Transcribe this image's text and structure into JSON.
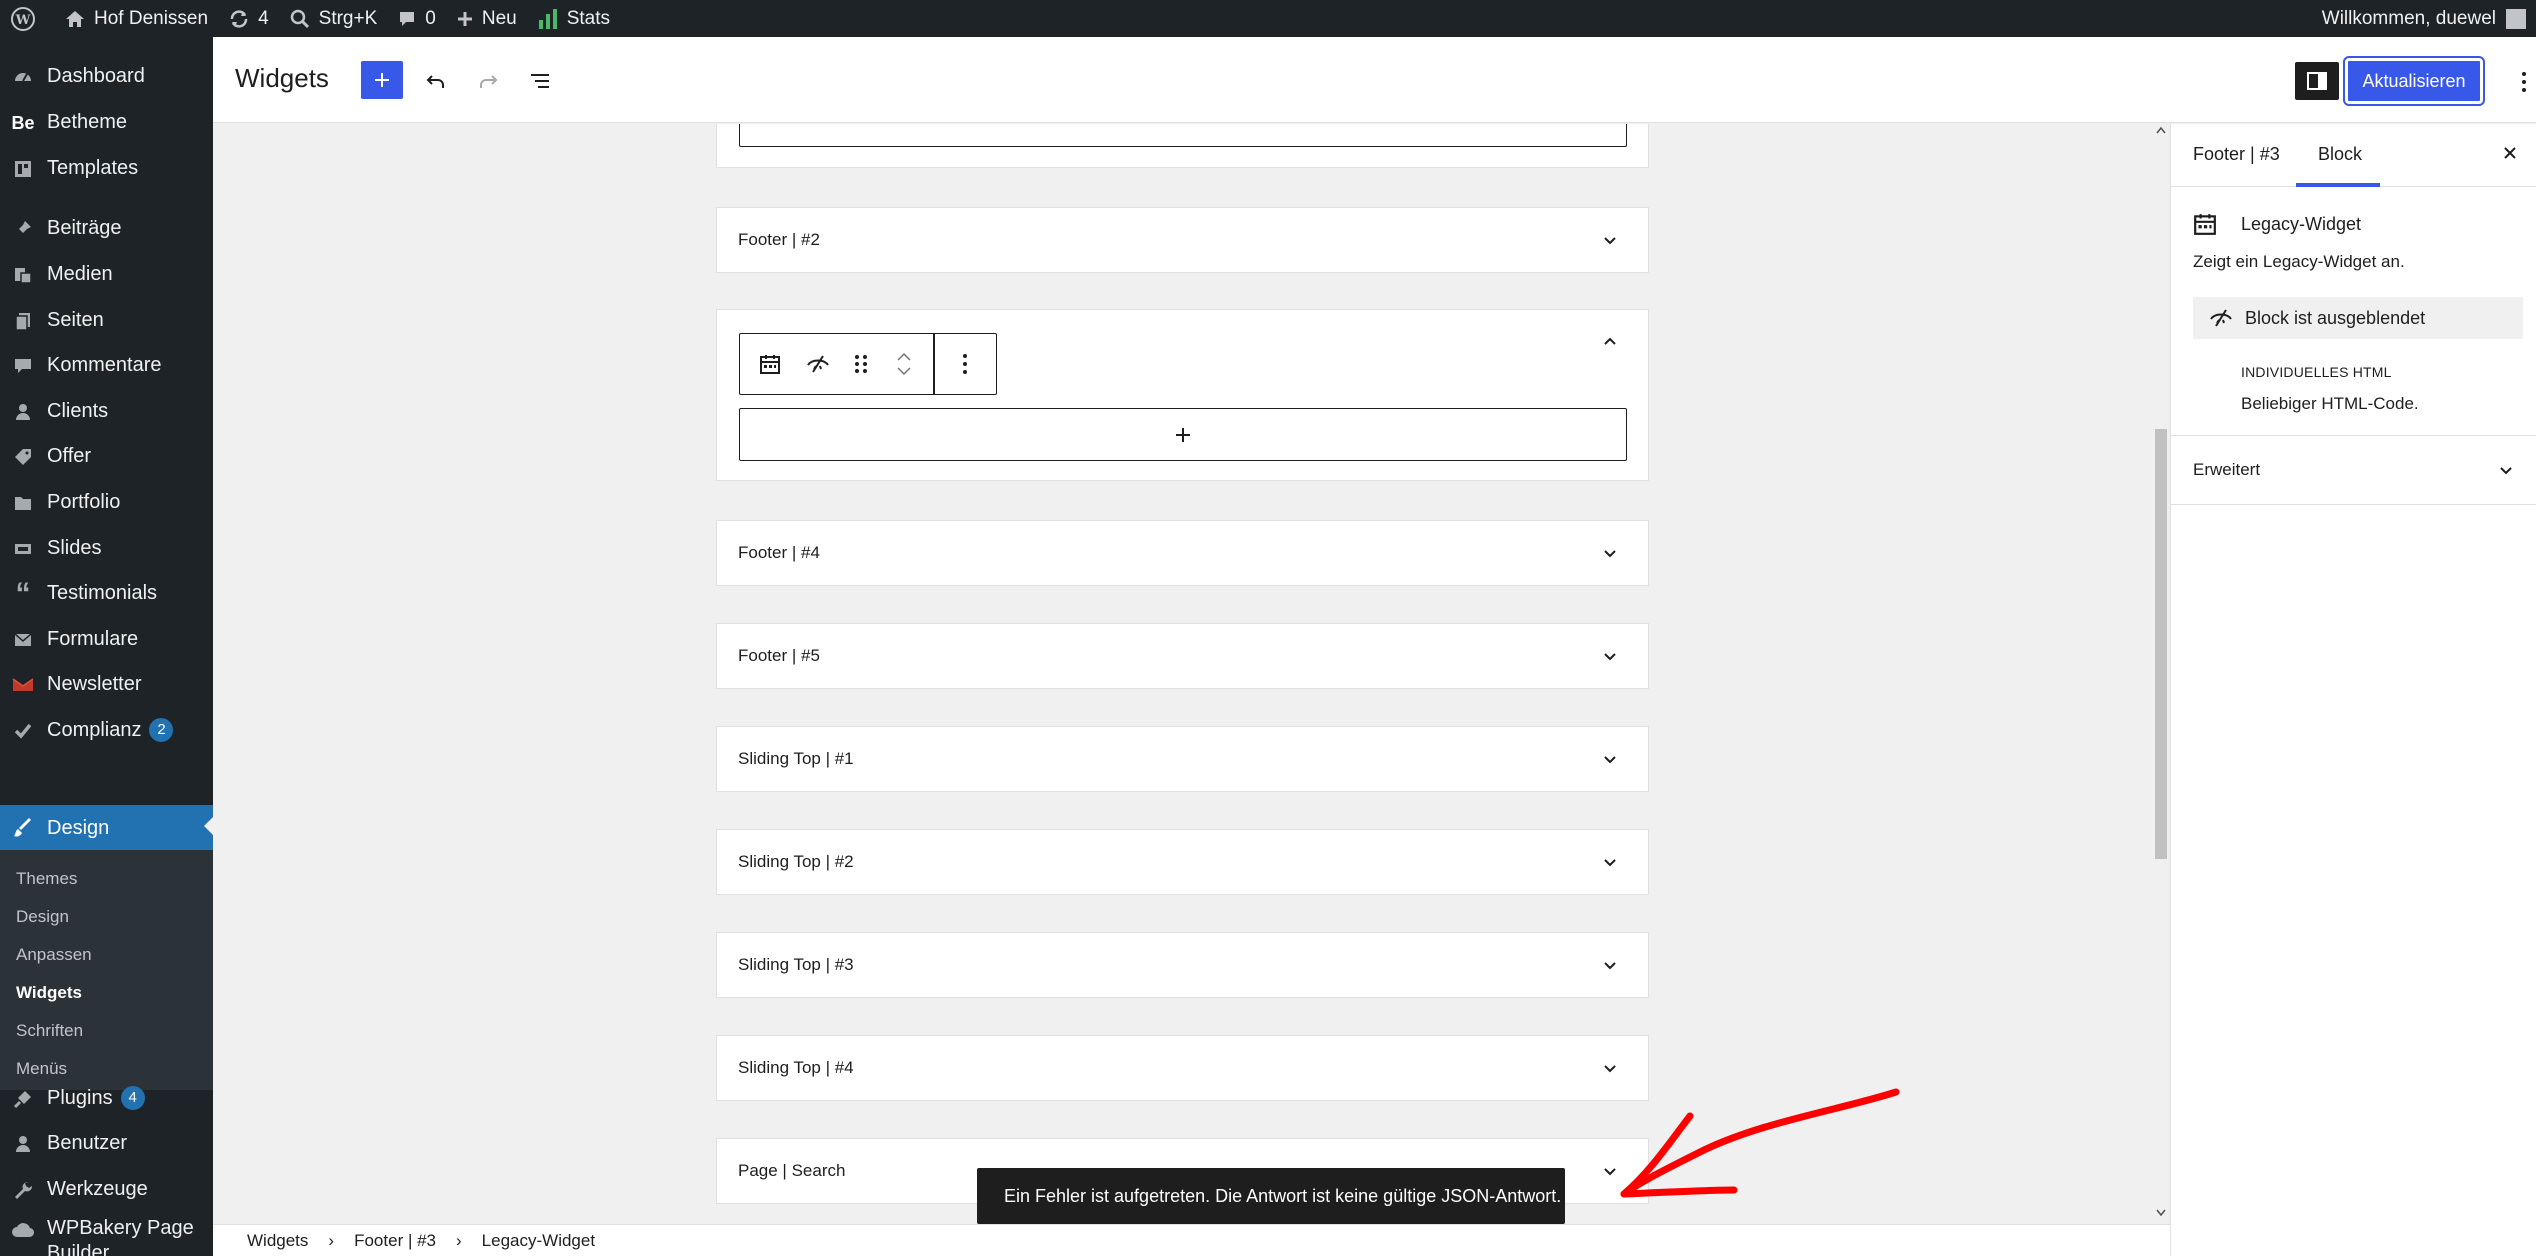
{
  "adminbar": {
    "site_name": "Hof Denissen",
    "updates_count": "4",
    "search_label": "Strg+K",
    "comments_count": "0",
    "new_label": "Neu",
    "stats_label": "Stats",
    "welcome": "Willkommen, duewel"
  },
  "sidebar": {
    "items": [
      {
        "label": "Dashboard",
        "icon": "dashboard-icon"
      },
      {
        "label": "Betheme",
        "icon": "betheme-logo-icon"
      },
      {
        "label": "Templates",
        "icon": "templates-icon"
      },
      {
        "label": "Beiträge",
        "icon": "pin-icon"
      },
      {
        "label": "Medien",
        "icon": "media-icon"
      },
      {
        "label": "Seiten",
        "icon": "pages-icon"
      },
      {
        "label": "Kommentare",
        "icon": "comment-icon"
      },
      {
        "label": "Clients",
        "icon": "user-icon"
      },
      {
        "label": "Offer",
        "icon": "tag-icon"
      },
      {
        "label": "Portfolio",
        "icon": "folder-icon"
      },
      {
        "label": "Slides",
        "icon": "slides-icon"
      },
      {
        "label": "Testimonials",
        "icon": "quote-icon"
      },
      {
        "label": "Formulare",
        "icon": "mail-icon"
      },
      {
        "label": "Newsletter",
        "icon": "newsletter-icon"
      },
      {
        "label": "Complianz",
        "icon": "check-icon",
        "badge": "2"
      },
      {
        "label": "Design",
        "icon": "brush-icon"
      },
      {
        "label": "Plugins",
        "icon": "plugin-icon",
        "badge": "4"
      },
      {
        "label": "Benutzer",
        "icon": "user-icon"
      },
      {
        "label": "Werkzeuge",
        "icon": "wrench-icon"
      },
      {
        "label": "WPBakery Page Builder",
        "icon": "cloud-icon"
      }
    ],
    "submenu": [
      "Themes",
      "Design",
      "Anpassen",
      "Widgets",
      "Schriften",
      "Menüs"
    ]
  },
  "topbar": {
    "title": "Widgets",
    "update_label": "Aktualisieren"
  },
  "widget_areas": [
    "Footer | #2",
    "Footer | #4",
    "Footer | #5",
    "Sliding Top | #1",
    "Sliding Top | #2",
    "Sliding Top | #3",
    "Sliding Top | #4",
    "Page | Search"
  ],
  "inspector": {
    "tab_area": "Footer | #3",
    "tab_block": "Block",
    "block_title": "Legacy-Widget",
    "block_desc": "Zeigt ein Legacy-Widget an.",
    "hidden_label": "Block ist ausgeblendet",
    "widget_type": "INDIVIDUELLES HTML",
    "widget_desc": "Beliebiger HTML-Code.",
    "advanced_label": "Erweitert"
  },
  "breadcrumb": [
    "Widgets",
    "Footer | #3",
    "Legacy-Widget"
  ],
  "snackbar": "Ein Fehler ist aufgetreten. Die Antwort ist keine gültige JSON-Antwort.",
  "colors": {
    "accent": "#3858e9",
    "admin_dark": "#1d2327",
    "active_menu": "#2271b1",
    "annotation": "#ff0000"
  }
}
